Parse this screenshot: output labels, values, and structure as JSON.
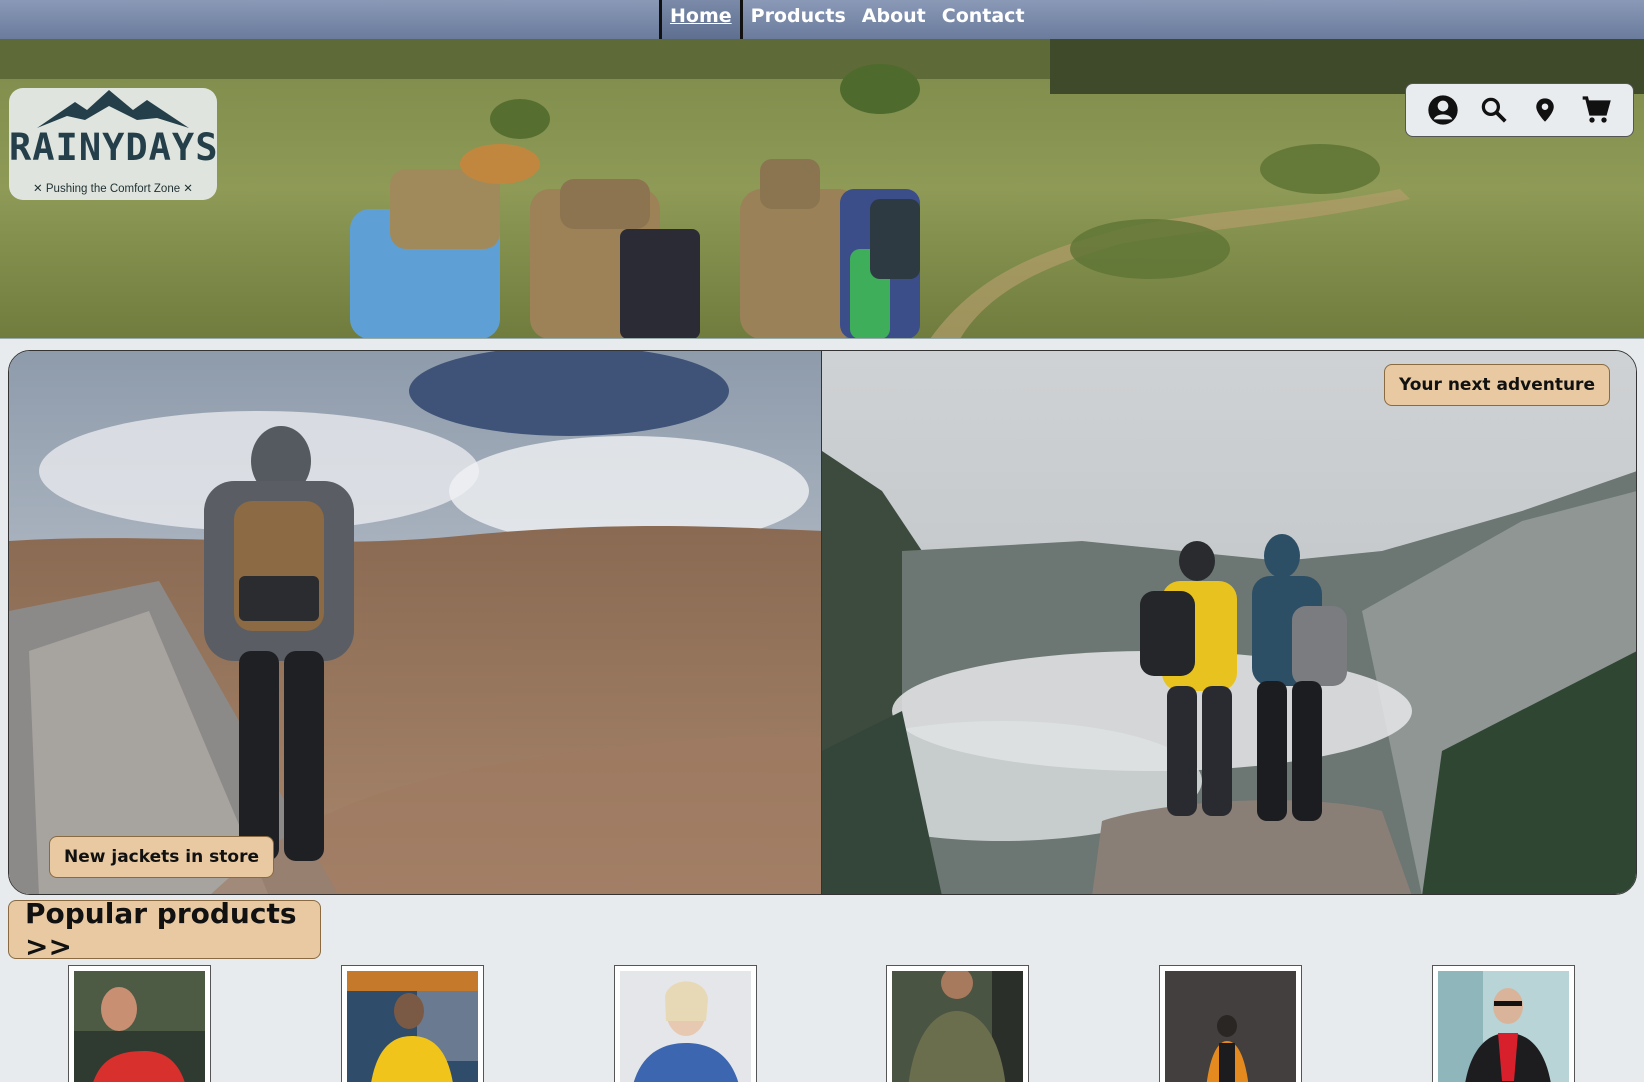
{
  "nav": {
    "links": [
      {
        "label": "Home",
        "active": true
      },
      {
        "label": "Products",
        "active": false
      },
      {
        "label": "About",
        "active": false
      },
      {
        "label": "Contact",
        "active": false
      }
    ]
  },
  "logo": {
    "brand": "RAINYDAYS",
    "tagline": "✕ Pushing the Comfort Zone ✕"
  },
  "header_icons": [
    "account-icon",
    "search-icon",
    "location-pin-icon",
    "cart-icon"
  ],
  "features": {
    "left_label": "New jackets in store",
    "right_label": "Your next adventure"
  },
  "popular": {
    "heading": "Popular products >>"
  },
  "colors": {
    "nav_bg": "#7789a8",
    "accent_tan": "#e8c9a2",
    "page_bg": "#e8ebee",
    "logo_navy": "#1f3b4a"
  }
}
